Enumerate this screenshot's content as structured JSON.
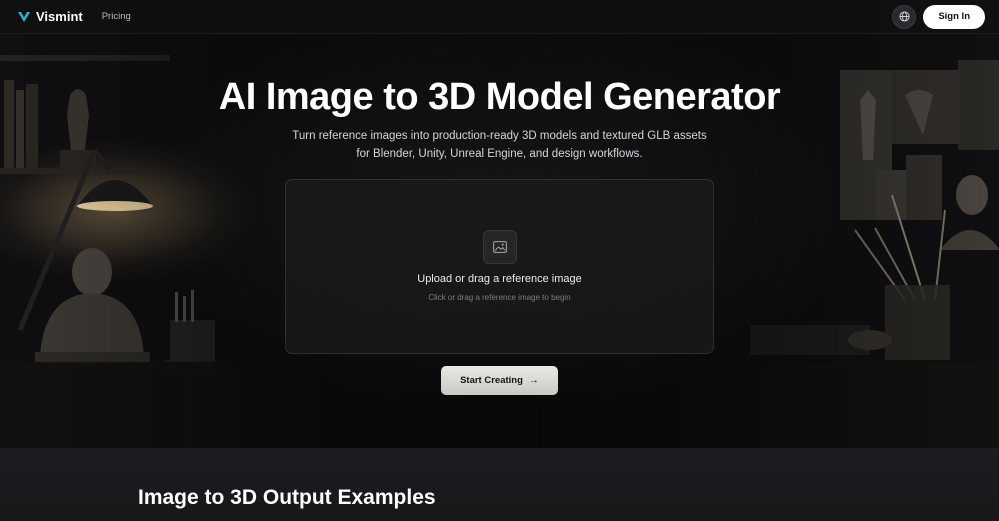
{
  "nav": {
    "brand": "Vismint",
    "pricing_label": "Pricing",
    "signin_label": "Sign In",
    "icons": {
      "logo": "v-logo-icon",
      "language": "globe-icon"
    },
    "brand_color": "#2bb8d6"
  },
  "hero": {
    "title": "AI Image to 3D Model Generator",
    "subtitle_line1": "Turn reference images into production-ready 3D models and textured GLB assets",
    "subtitle_line2": "for Blender, Unity, Unreal Engine, and design workflows."
  },
  "upload": {
    "title": "Upload or drag a reference image",
    "hint": "Click or drag a reference image to begin",
    "icon": "image-icon"
  },
  "cta": {
    "label": "Start Creating",
    "arrow": "→"
  },
  "examples": {
    "title": "Image to 3D Output Examples"
  }
}
